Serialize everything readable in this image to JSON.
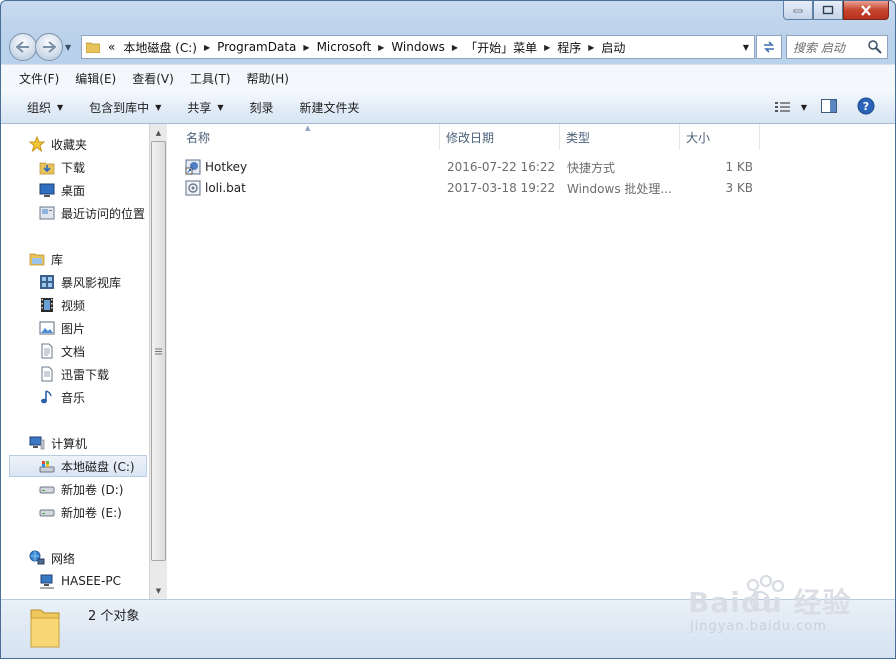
{
  "window": {
    "caption_buttons": {
      "minimize": "minimize",
      "maximize": "maximize",
      "close": "close"
    }
  },
  "address_bar": {
    "overflow": "«",
    "crumbs": [
      "本地磁盘 (C:)",
      "ProgramData",
      "Microsoft",
      "Windows",
      "「开始」菜单",
      "程序",
      "启动"
    ]
  },
  "search": {
    "placeholder": "搜索 启动"
  },
  "menu": [
    "文件(F)",
    "编辑(E)",
    "查看(V)",
    "工具(T)",
    "帮助(H)"
  ],
  "toolbar": {
    "organize": "组织",
    "include_library": "包含到库中",
    "share": "共享",
    "burn": "刻录",
    "new_folder": "新建文件夹"
  },
  "sidebar": {
    "favorites": {
      "label": "收藏夹",
      "items": [
        "下载",
        "桌面",
        "最近访问的位置"
      ]
    },
    "libraries": {
      "label": "库",
      "items": [
        "暴风影视库",
        "视频",
        "图片",
        "文档",
        "迅雷下载",
        "音乐"
      ]
    },
    "computer": {
      "label": "计算机",
      "items": [
        "本地磁盘 (C:)",
        "新加卷 (D:)",
        "新加卷 (E:)"
      ]
    },
    "network": {
      "label": "网络",
      "items": [
        "HASEE-PC"
      ]
    }
  },
  "columns": {
    "name": "名称",
    "modified": "修改日期",
    "type": "类型",
    "size": "大小"
  },
  "files": [
    {
      "name": "Hotkey",
      "modified": "2016-07-22 16:22",
      "type": "快捷方式",
      "size": "1 KB"
    },
    {
      "name": "loli.bat",
      "modified": "2017-03-18 19:22",
      "type": "Windows 批处理...",
      "size": "3 KB"
    }
  ],
  "status": {
    "count": "2 个对象"
  },
  "watermark": {
    "logo": "Baidu 经验",
    "url": "jingyan.baidu.com"
  },
  "colors": {
    "accent": "#4a6e95",
    "selection": "#d9e5f3"
  }
}
